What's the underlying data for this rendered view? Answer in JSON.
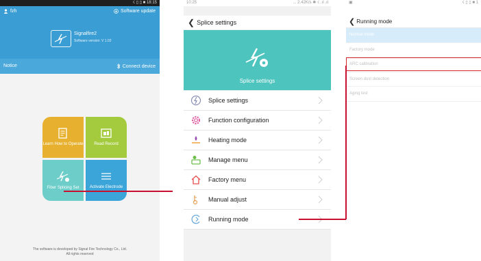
{
  "screen1": {
    "status": {
      "left": "",
      "right": "☇ ▯ ▯ ■ 18:15"
    },
    "user": {
      "name": "fzh"
    },
    "software_update": "Software update",
    "app_name": "Signalfire2",
    "version": "Software version: V 1.02",
    "notice": "Notice",
    "connect_device": "Connect device",
    "tiles": [
      {
        "label": "Learn How to Operate",
        "icon": "document-icon",
        "color": "#e7b12f"
      },
      {
        "label": "Read Record",
        "icon": "record-icon",
        "color": "#a4cb3e"
      },
      {
        "label": "Fiber Splicing Set",
        "icon": "splice-gear-icon",
        "color": "#6ccdc9"
      },
      {
        "label": "Activate Electrode",
        "icon": "electrode-icon",
        "color": "#3ba4d9"
      }
    ],
    "footer_line1": "The software is developed by Signal Fire Technology Co., Ltd.",
    "footer_line2": "All rights reserved"
  },
  "screen2": {
    "status": {
      "left": "10:25",
      "right": "... 2.42K/s ✱ ☇ .ıl .ıl"
    },
    "title": "Splice settings",
    "banner_label": "Splice settings",
    "menu": [
      {
        "label": "Splice settings",
        "icon": "lightning-icon"
      },
      {
        "label": "Function configuration",
        "icon": "gear-icon"
      },
      {
        "label": "Heating mode",
        "icon": "heating-icon"
      },
      {
        "label": "Manage menu",
        "icon": "manage-icon"
      },
      {
        "label": "Factory menu",
        "icon": "house-icon"
      },
      {
        "label": "Manual adjust",
        "icon": "adjust-icon"
      },
      {
        "label": "Running mode",
        "icon": "running-icon"
      }
    ]
  },
  "screen3": {
    "status": {
      "left": "▣",
      "right": "☇ ▯ ▯ ■ 1"
    },
    "title": "Running mode",
    "items": [
      {
        "label": "Normal mode",
        "selected": true
      },
      {
        "label": "Factory mode",
        "selected": false
      },
      {
        "label": "ARC calibration",
        "selected": false
      },
      {
        "label": "Screen dust detection",
        "selected": false
      },
      {
        "label": "Aging test",
        "selected": false
      }
    ]
  },
  "colors": {
    "header_blue": "#3a9dd3",
    "teal_banner": "#4dc4bd",
    "highlight_red": "#d8242a"
  }
}
